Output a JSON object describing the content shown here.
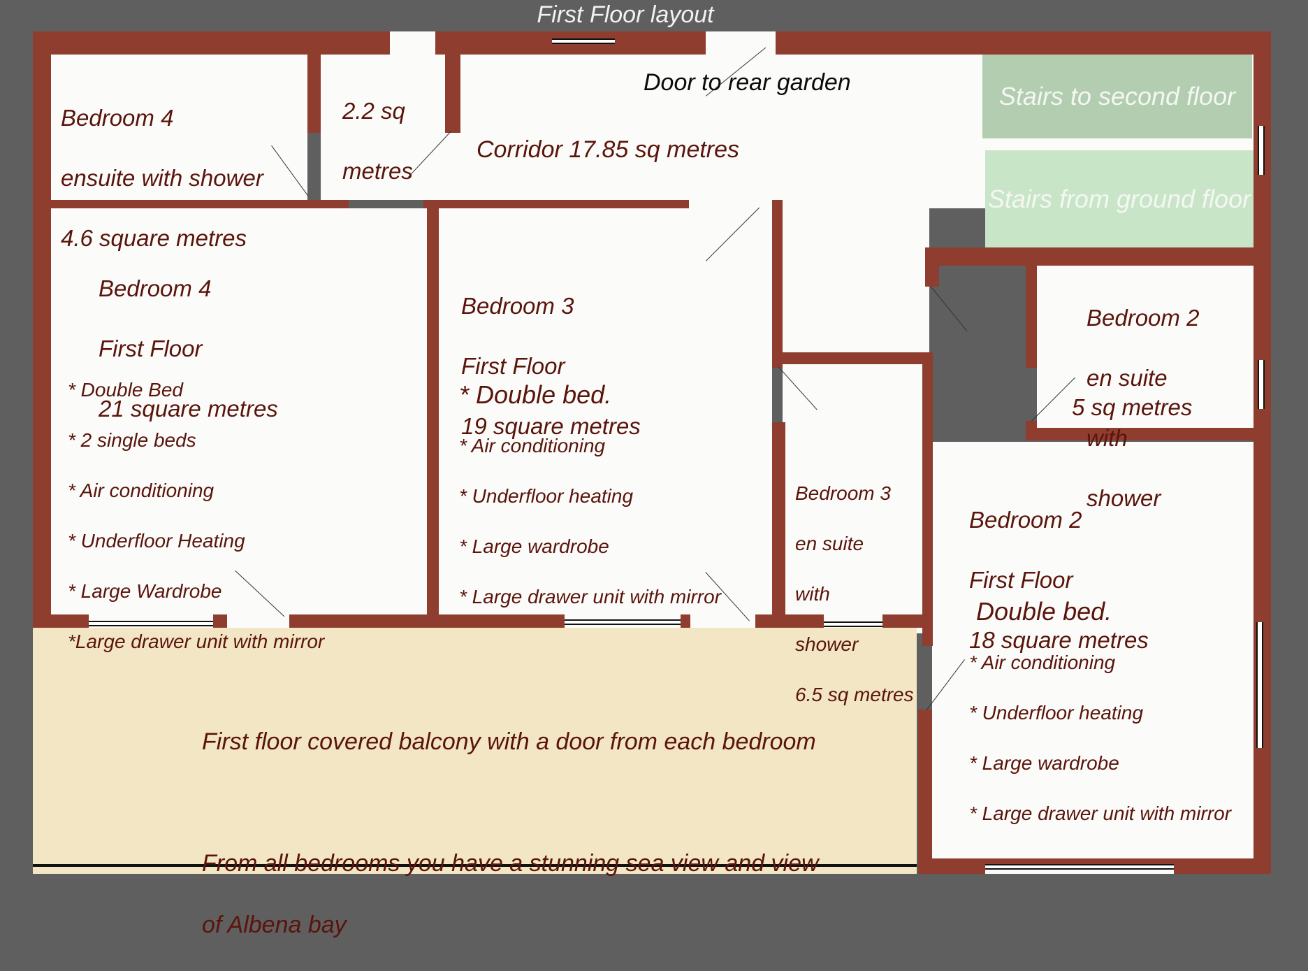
{
  "title": "First Floor layout",
  "colors": {
    "wall": "#8f3d2e",
    "floor": "#fbfcf9",
    "balcony": "#f3e6c5",
    "stairs_up": "#b2cdb0",
    "stairs_down": "#c9e5c8",
    "text": "#5a140c",
    "background": "#5f5f5f"
  },
  "rooms": {
    "bedroom4_ensuite": {
      "lines": [
        "Bedroom 4",
        "ensuite with shower",
        "4.6 square metres"
      ]
    },
    "wc": {
      "lines": [
        "2.2 sq",
        "metres"
      ]
    },
    "corridor": {
      "label": "Corridor 17.85 sq metres",
      "door_label": "Door to rear garden"
    },
    "stairs_up": {
      "label": "Stairs to second floor"
    },
    "stairs_down": {
      "label": "Stairs from ground floor"
    },
    "bedroom4": {
      "lines": [
        "Bedroom 4",
        "First Floor",
        "21 square metres"
      ],
      "features": [
        "* Double Bed",
        "* 2 single beds",
        "* Air conditioning",
        "* Underfloor Heating",
        "* Large Wardrobe",
        "*Large drawer unit with mirror"
      ]
    },
    "bedroom3": {
      "lines": [
        "Bedroom 3",
        "First Floor",
        "19 square metres"
      ],
      "headline_feature": "* Double bed.",
      "features": [
        "* Air conditioning",
        "* Underfloor heating",
        "* Large wardrobe",
        "* Large drawer unit with mirror"
      ]
    },
    "bedroom3_ensuite": {
      "lines": [
        "Bedroom 3",
        "en suite",
        "with",
        "shower",
        "6.5 sq metres"
      ]
    },
    "bedroom2_ensuite": {
      "lines": [
        "Bedroom 2",
        "en suite",
        "with",
        "shower"
      ],
      "area": "5 sq metres"
    },
    "bedroom2": {
      "lines": [
        "Bedroom 2",
        "First Floor",
        "18 square metres"
      ],
      "headline_feature": "Double bed.",
      "features": [
        "* Air conditioning",
        "* Underfloor heating",
        "* Large wardrobe",
        "* Large drawer unit with mirror"
      ]
    },
    "balcony": {
      "line1": "First floor covered balcony with a door from each bedroom",
      "line2": "From all bedrooms you have a stunning sea view and view",
      "line3": "of Albena bay"
    }
  }
}
